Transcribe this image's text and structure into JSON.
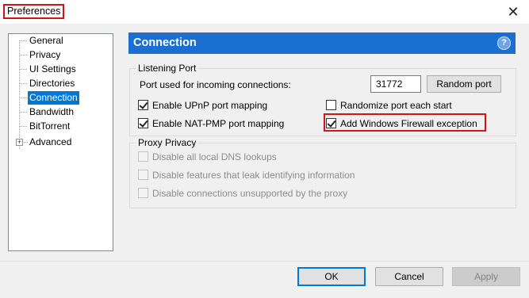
{
  "window": {
    "title": "Preferences",
    "close_glyph": "✕"
  },
  "tree": {
    "items": [
      {
        "label": "General",
        "selected": false
      },
      {
        "label": "Privacy",
        "selected": false
      },
      {
        "label": "UI Settings",
        "selected": false
      },
      {
        "label": "Directories",
        "selected": false
      },
      {
        "label": "Connection",
        "selected": true
      },
      {
        "label": "Bandwidth",
        "selected": false
      },
      {
        "label": "BitTorrent",
        "selected": false
      },
      {
        "label": "Advanced",
        "selected": false,
        "expandable": true,
        "expander_glyph": "+"
      }
    ]
  },
  "panel": {
    "title": "Connection",
    "help_glyph": "?",
    "listening_port": {
      "group_label": "Listening Port",
      "port_label": "Port used for incoming connections:",
      "port_value": "31772",
      "random_port_label": "Random port",
      "options": [
        {
          "label": "Enable UPnP port mapping",
          "checked": true
        },
        {
          "label": "Randomize port each start",
          "checked": false
        },
        {
          "label": "Enable NAT-PMP port mapping",
          "checked": true
        },
        {
          "label": "Add Windows Firewall exception",
          "checked": true,
          "highlighted": true
        }
      ]
    },
    "proxy_privacy": {
      "group_label": "Proxy Privacy",
      "options": [
        {
          "label": "Disable all local DNS lookups",
          "checked": false,
          "disabled": true
        },
        {
          "label": "Disable features that leak identifying information",
          "checked": false,
          "disabled": true
        },
        {
          "label": "Disable connections unsupported by the proxy",
          "checked": false,
          "disabled": true
        }
      ]
    }
  },
  "buttons": {
    "ok": "OK",
    "cancel": "Cancel",
    "apply": "Apply"
  },
  "colors": {
    "accent": "#1a6fd1",
    "selection": "#0078d7",
    "highlight": "#d41414"
  }
}
